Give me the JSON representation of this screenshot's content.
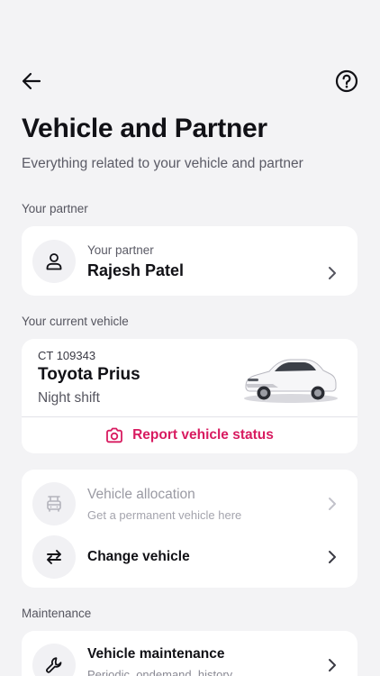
{
  "header": {
    "title": "Vehicle and Partner",
    "subtitle": "Everything related to your vehicle and partner",
    "back_icon": "arrow-left-icon",
    "help_icon": "question-circle-icon"
  },
  "partner_section": {
    "label": "Your partner",
    "card_caption": "Your partner",
    "name": "Rajesh Patel",
    "icon": "person-icon"
  },
  "vehicle_section": {
    "label": "Your current vehicle",
    "plate": "CT 109343",
    "model": "Toyota Prius",
    "shift": "Night shift",
    "report_label": "Report vehicle status",
    "report_icon": "camera-icon"
  },
  "actions": {
    "allocation": {
      "title": "Vehicle allocation",
      "subtitle": "Get a permanent vehicle here",
      "icon": "car-seat-icon",
      "disabled": true
    },
    "change_vehicle": {
      "title": "Change vehicle",
      "icon": "swap-arrows-icon"
    }
  },
  "maintenance_section": {
    "label": "Maintenance",
    "title": "Vehicle maintenance",
    "subtitle": "Periodic, ondemand, history",
    "icon": "wrench-icon"
  },
  "colors": {
    "background": "#f3f3f5",
    "card": "#ffffff",
    "accent": "#d81b60",
    "text_primary": "#111116",
    "text_secondary": "#5b5b66",
    "text_disabled": "#a4a4ad"
  }
}
